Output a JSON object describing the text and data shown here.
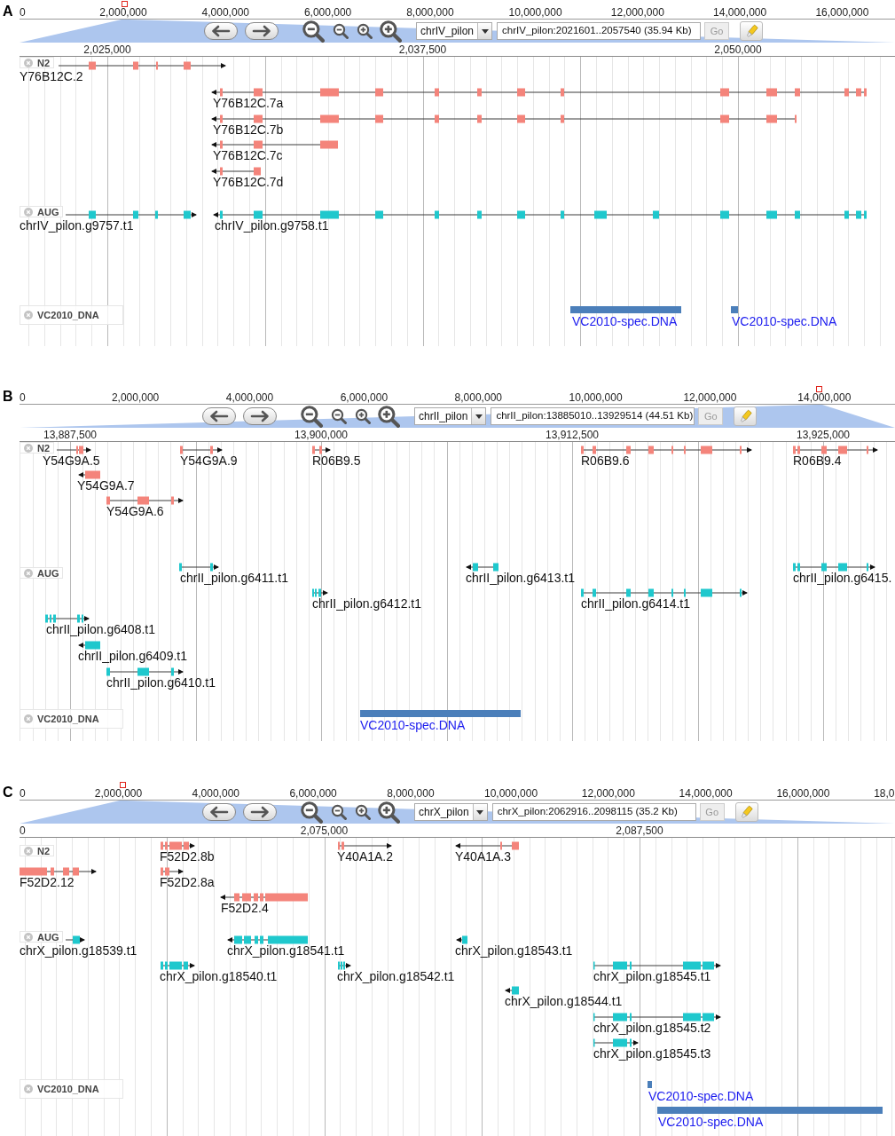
{
  "panels": [
    {
      "letter": "A",
      "overview_ticks": [
        "0",
        "2,000,000",
        "4,000,000",
        "6,000,000",
        "8,000,000",
        "10,000,000",
        "12,000,000",
        "14,000,000",
        "16,000,000"
      ],
      "nav": {
        "chromosome": "chrIV_pilon",
        "location": "chrIV_pilon:2021601..2057540 (35.94 Kb)",
        "go": {
          "label": "Go",
          "disabled": true
        }
      },
      "ruler_ticks": [
        "2,025,000",
        "2,037,500",
        "2,050,000"
      ],
      "tracks": [
        {
          "name": "N2",
          "kind": "genes",
          "color": "#f4847b",
          "features": [
            {
              "label": "Y76B12C.2",
              "reverse": false
            },
            {
              "label": "Y76B12C.7a",
              "reverse": true
            },
            {
              "label": "Y76B12C.7b",
              "reverse": true
            },
            {
              "label": "Y76B12C.7c",
              "reverse": true
            },
            {
              "label": "Y76B12C.7d",
              "reverse": true
            }
          ]
        },
        {
          "name": "AUG",
          "kind": "genes",
          "color": "#1fc8cd",
          "features": [
            {
              "label": "chrIV_pilon.g9757.t1",
              "reverse": false
            },
            {
              "label": "chrIV_pilon.g9758.t1",
              "reverse": true
            }
          ]
        },
        {
          "name": "VC2010_DNA",
          "kind": "regions",
          "color": "#4b7fba",
          "features": [
            {
              "label": "VC2010-spec.DNA"
            },
            {
              "label": "VC2010-spec.DNA"
            }
          ]
        }
      ]
    },
    {
      "letter": "B",
      "overview_ticks": [
        "0",
        "2,000,000",
        "4,000,000",
        "6,000,000",
        "8,000,000",
        "10,000,000",
        "12,000,000",
        "14,000,000"
      ],
      "nav": {
        "chromosome": "chrII_pilon",
        "location": "chrII_pilon:13885010..13929514 (44.51 Kb)",
        "go": {
          "label": "Go",
          "disabled": true
        }
      },
      "ruler_ticks": [
        "13,887,500",
        "13,900,000",
        "13,912,500",
        "13,925,000"
      ],
      "tracks": [
        {
          "name": "N2",
          "kind": "genes",
          "color": "#f4847b",
          "features": [
            {
              "label": "Y54G9A.5",
              "reverse": false
            },
            {
              "label": "Y54G9A.9",
              "reverse": false
            },
            {
              "label": "R06B9.5",
              "reverse": false
            },
            {
              "label": "R06B9.6",
              "reverse": false
            },
            {
              "label": "R06B9.4",
              "reverse": false
            },
            {
              "label": "Y54G9A.7",
              "reverse": true
            },
            {
              "label": "Y54G9A.6",
              "reverse": false
            }
          ]
        },
        {
          "name": "AUG",
          "kind": "genes",
          "color": "#1fc8cd",
          "features": [
            {
              "label": "chrII_pilon.g6411.t1",
              "reverse": false
            },
            {
              "label": "chrII_pilon.g6413.t1",
              "reverse": true
            },
            {
              "label": "chrII_pilon.g6415.",
              "reverse": false
            },
            {
              "label": "chrII_pilon.g6412.t1",
              "reverse": false
            },
            {
              "label": "chrII_pilon.g6414.t1",
              "reverse": false
            },
            {
              "label": "chrII_pilon.g6408.t1",
              "reverse": false
            },
            {
              "label": "chrII_pilon.g6409.t1",
              "reverse": true
            },
            {
              "label": "chrII_pilon.g6410.t1",
              "reverse": false
            }
          ]
        },
        {
          "name": "VC2010_DNA",
          "kind": "regions",
          "color": "#4b7fba",
          "features": [
            {
              "label": "VC2010-spec.DNA"
            }
          ]
        }
      ]
    },
    {
      "letter": "C",
      "overview_ticks": [
        "0",
        "2,000,000",
        "4,000,000",
        "6,000,000",
        "8,000,000",
        "10,000,000",
        "12,000,000",
        "14,000,000",
        "16,000,000",
        "18,0"
      ],
      "nav": {
        "chromosome": "chrX_pilon",
        "location": "chrX_pilon:2062916..2098115 (35.2 Kb)",
        "go": {
          "label": "Go",
          "disabled": true
        }
      },
      "ruler_ticks": [
        "0",
        "2,075,000",
        "2,087,500"
      ],
      "tracks": [
        {
          "name": "N2",
          "kind": "genes",
          "color": "#f4847b",
          "features": [
            {
              "label": "F52D2.8b",
              "reverse": false
            },
            {
              "label": "Y40A1A.2",
              "reverse": false
            },
            {
              "label": "Y40A1A.3",
              "reverse": true
            },
            {
              "label": "F52D2.12",
              "reverse": false
            },
            {
              "label": "F52D2.8a",
              "reverse": false
            },
            {
              "label": "F52D2.4",
              "reverse": true
            }
          ]
        },
        {
          "name": "AUG",
          "kind": "genes",
          "color": "#1fc8cd",
          "features": [
            {
              "label": "chrX_pilon.g18539.t1",
              "reverse": false
            },
            {
              "label": "chrX_pilon.g18541.t1",
              "reverse": true
            },
            {
              "label": "chrX_pilon.g18543.t1",
              "reverse": true
            },
            {
              "label": "chrX_pilon.g18540.t1",
              "reverse": false
            },
            {
              "label": "chrX_pilon.g18542.t1",
              "reverse": false
            },
            {
              "label": "chrX_pilon.g18545.t1",
              "reverse": false
            },
            {
              "label": "chrX_pilon.g18544.t1",
              "reverse": true
            },
            {
              "label": "chrX_pilon.g18545.t2",
              "reverse": false
            },
            {
              "label": "chrX_pilon.g18545.t3",
              "reverse": false
            }
          ]
        },
        {
          "name": "VC2010_DNA",
          "kind": "regions",
          "color": "#4b7fba",
          "features": [
            {
              "label": "VC2010-spec.DNA"
            },
            {
              "label": "VC2010-spec.DNA"
            }
          ]
        }
      ]
    }
  ]
}
